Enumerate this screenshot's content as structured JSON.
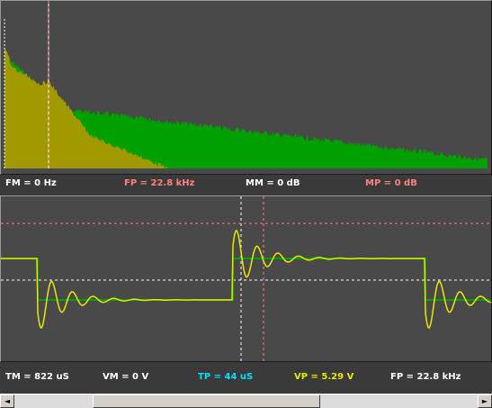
{
  "spectrum": {
    "readouts": {
      "fm": "FM = 0 Hz",
      "fp": "FP = 22.8 kHz",
      "mm": "MM = 0 dB",
      "mp": "MP = 0 dB"
    },
    "colors": {
      "background": "#494949",
      "signal": "#00a000",
      "reference": "#a09a00",
      "cursor_m": "#ffffff",
      "cursor_p": "#ff8080"
    }
  },
  "scope": {
    "readouts": {
      "tm": "TM = 822 uS",
      "vm": "VM = 0 V",
      "tp": "TP = 44 uS",
      "vp": "VP = 5.29 V",
      "fp": "FP = 22.8 kHz"
    },
    "colors": {
      "background": "#494949",
      "reference_trace": "#00a000",
      "signal_trace": "#e8e800",
      "cursor_m": "#ffffff",
      "cursor_p": "#ff8080"
    }
  },
  "scrollbar": {
    "left_arrow": "◄",
    "right_arrow": "►"
  }
}
